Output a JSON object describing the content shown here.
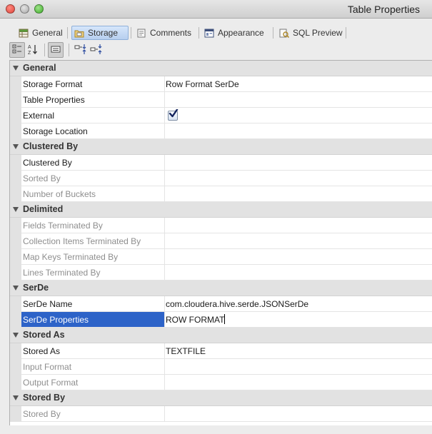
{
  "window": {
    "title": "Table Properties"
  },
  "tabs": [
    {
      "label": "General",
      "icon": "table-icon",
      "active": false
    },
    {
      "label": "Storage",
      "icon": "storage-icon",
      "active": true
    },
    {
      "label": "Comments",
      "icon": "comments-icon",
      "active": false
    },
    {
      "label": "Appearance",
      "icon": "appearance-icon",
      "active": false
    },
    {
      "label": "SQL Preview",
      "icon": "sql-preview-icon",
      "active": false
    }
  ],
  "toolbar": {
    "buttons": [
      {
        "name": "categorized-view-button",
        "icon": "categorized-icon",
        "pressed": true
      },
      {
        "name": "sort-alphabetical-button",
        "icon": "sort-az-icon",
        "pressed": false
      },
      {
        "name": "description-toggle-button",
        "icon": "description-icon",
        "pressed": true
      },
      {
        "name": "expand-all-button",
        "icon": "expand-all-icon",
        "pressed": false
      },
      {
        "name": "collapse-all-button",
        "icon": "collapse-all-icon",
        "pressed": false
      }
    ]
  },
  "properties": {
    "categories": [
      {
        "label": "General",
        "rows": [
          {
            "name": "Storage Format",
            "value": "Row Format SerDe",
            "disabled": false
          },
          {
            "name": "Table Properties",
            "value": "",
            "disabled": false
          },
          {
            "name": "External",
            "value": "",
            "checkbox": true,
            "checked": true,
            "disabled": false
          },
          {
            "name": "Storage Location",
            "value": "",
            "disabled": false
          }
        ]
      },
      {
        "label": "Clustered By",
        "rows": [
          {
            "name": "Clustered By",
            "value": "",
            "disabled": false
          },
          {
            "name": "Sorted By",
            "value": "",
            "disabled": true
          },
          {
            "name": "Number of Buckets",
            "value": "",
            "disabled": true
          }
        ]
      },
      {
        "label": "Delimited",
        "rows": [
          {
            "name": "Fields Terminated By",
            "value": "",
            "disabled": true
          },
          {
            "name": "Collection Items Terminated By",
            "value": "",
            "disabled": true
          },
          {
            "name": "Map Keys Terminated By",
            "value": "",
            "disabled": true
          },
          {
            "name": "Lines Terminated By",
            "value": "",
            "disabled": true
          }
        ]
      },
      {
        "label": "SerDe",
        "rows": [
          {
            "name": "SerDe Name",
            "value": "com.cloudera.hive.serde.JSONSerDe",
            "disabled": false
          },
          {
            "name": "SerDe Properties",
            "value": "ROW FORMAT",
            "disabled": false,
            "selected": true,
            "editing": true
          }
        ]
      },
      {
        "label": "Stored As",
        "rows": [
          {
            "name": "Stored As",
            "value": "TEXTFILE",
            "disabled": false
          },
          {
            "name": "Input Format",
            "value": "",
            "disabled": true
          },
          {
            "name": "Output Format",
            "value": "",
            "disabled": true
          }
        ]
      },
      {
        "label": "Stored By",
        "rows": [
          {
            "name": "Stored By",
            "value": "",
            "disabled": true
          }
        ]
      }
    ]
  },
  "colors": {
    "selection": "#2d63c8",
    "category_bg": "#e2e2e2",
    "disabled_text": "#8e8e8e",
    "active_tab": "#c4d9f4"
  }
}
